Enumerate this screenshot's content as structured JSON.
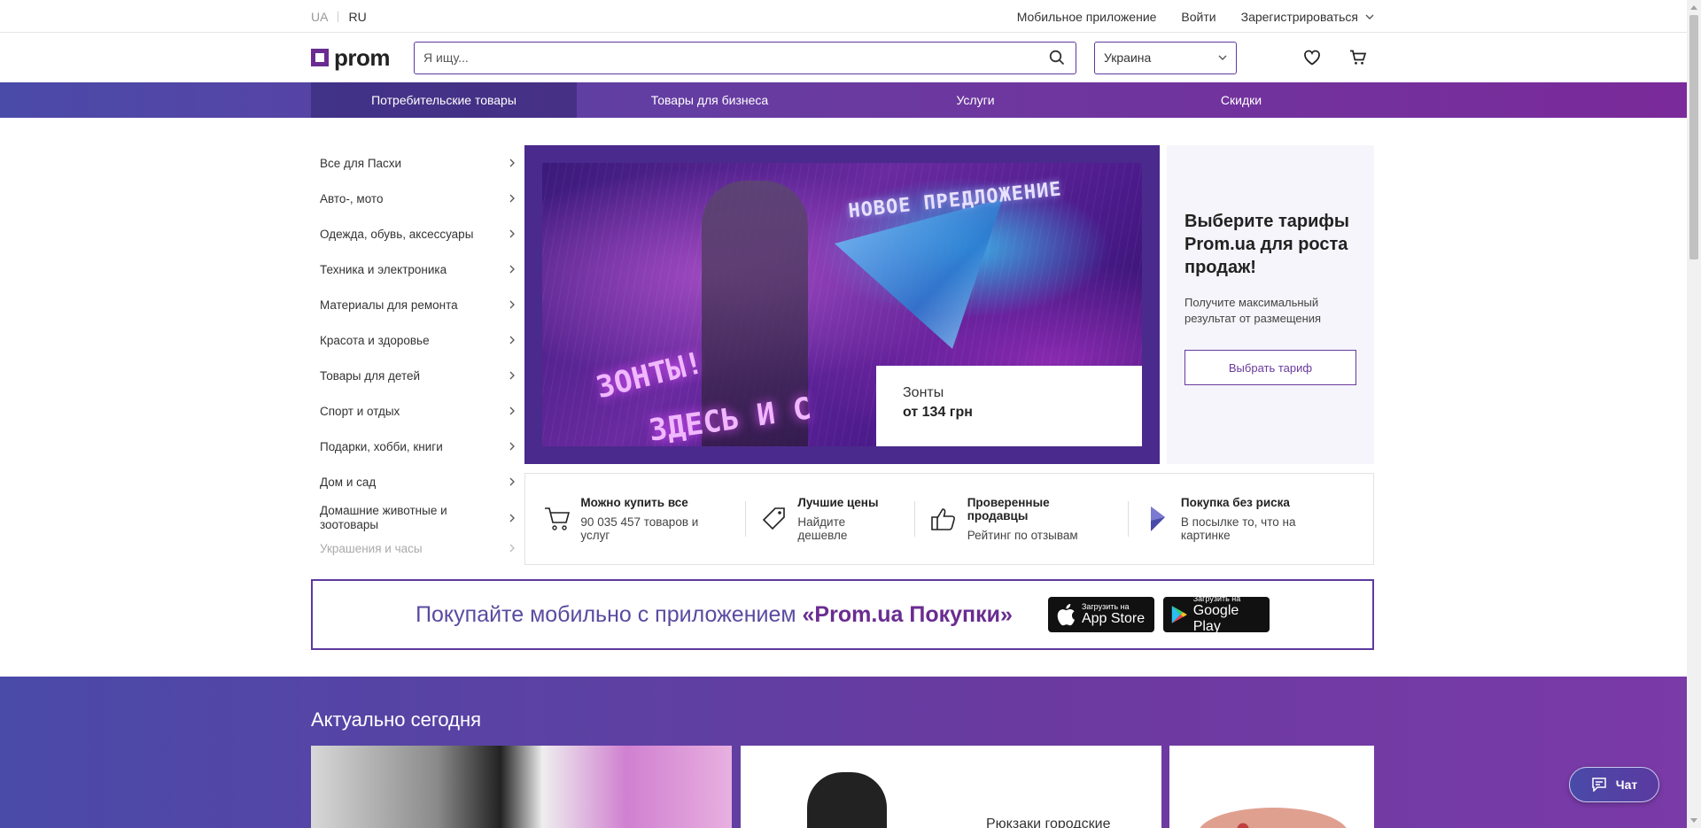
{
  "topbar": {
    "lang_ua": "UA",
    "lang_ru": "RU",
    "mobile_app": "Мобильное приложение",
    "login": "Войти",
    "register": "Зарегистрироваться"
  },
  "header": {
    "logo_text": "prom",
    "search_placeholder": "Я ищу...",
    "region": "Украина",
    "icons": [
      "search-icon",
      "heart-icon",
      "cart-icon"
    ]
  },
  "nav": {
    "items": [
      {
        "label": "Потребительские товары",
        "active": true
      },
      {
        "label": "Товары для бизнеса",
        "active": false
      },
      {
        "label": "Услуги",
        "active": false
      },
      {
        "label": "Скидки",
        "active": false
      }
    ]
  },
  "categories": [
    "Все для Пасхи",
    "Авто-, мото",
    "Одежда, обувь, аксессуары",
    "Техника и электроника",
    "Материалы для ремонта",
    "Красота и здоровье",
    "Товары для детей",
    "Спорт и отдых",
    "Подарки, хобби, книги",
    "Дом и сад",
    "Домашние животные и зоотовары",
    "Украшения и часы"
  ],
  "banner": {
    "neon_top": "НОВОЕ ПРЕДЛОЖЕНИЕ",
    "neon_line1": "ЗОНТЫ!",
    "neon_line2": "ЗДЕСЬ И С",
    "label_title": "Зонты",
    "label_price": "от 134 грн",
    "accent": "#4a2a8c"
  },
  "promo": {
    "title": "Выберите тарифы Prom.ua для роста продаж!",
    "text": "Получите максимальный результат от размещения",
    "button": "Выбрать тариф"
  },
  "features": [
    {
      "icon": "cart-icon",
      "title": "Можно купить все",
      "text": "90 035 457 товаров и услуг"
    },
    {
      "icon": "tag-icon",
      "title": "Лучшие цены",
      "text": "Найдите дешевле"
    },
    {
      "icon": "thumbs-up-icon",
      "title": "Проверенные продавцы",
      "text": "Рейтинг по отзывам"
    },
    {
      "icon": "shield-icon",
      "title": "Покупка без риска",
      "text": "В посылке то, что на картинке"
    }
  ],
  "app_banner": {
    "text": "Покупайте мобильно с приложением",
    "brand": "«Prom.ua Покупки»",
    "appstore_small": "Загрузить на",
    "appstore_big": "App Store",
    "googleplay_small": "Загрузить на",
    "googleplay_big": "Google Play"
  },
  "actual": {
    "title": "Актуально сегодня",
    "card2_title": "Рюкзаки городские"
  },
  "chat": {
    "label": "Чат"
  },
  "colors": {
    "brand": "#6a2c91",
    "nav_start": "#4a4aa8",
    "nav_end": "#7a2a9a"
  }
}
